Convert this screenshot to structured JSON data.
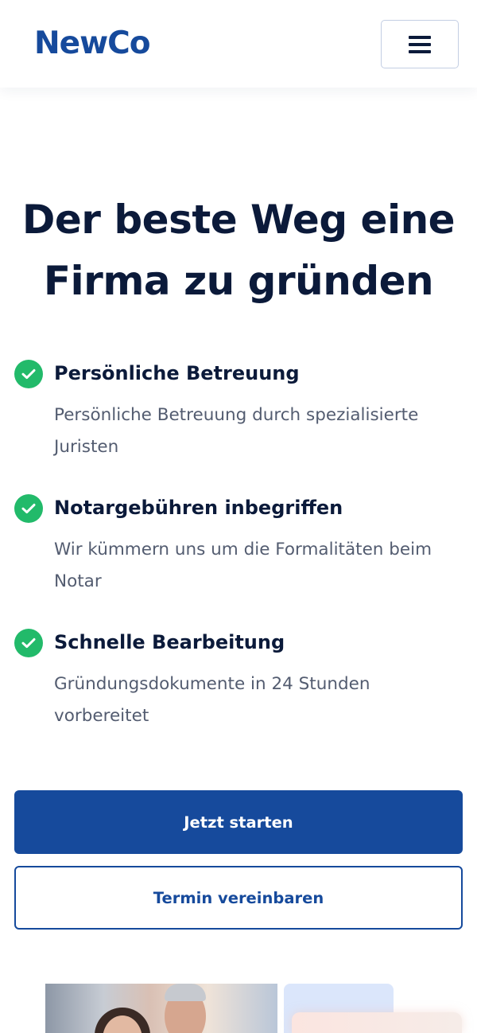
{
  "header": {
    "logo_text": "NewCo",
    "menu_icon": "hamburger-menu-icon"
  },
  "hero": {
    "title_line1": "Der beste Weg eine",
    "title_line2": "Firma zu gründen"
  },
  "features": [
    {
      "icon": "check-circle-icon",
      "title": "Persönliche Betreuung",
      "description": "Persönliche Betreuung durch spezialisierte Juristen"
    },
    {
      "icon": "check-circle-icon",
      "title": "Notargebühren inbegriffen",
      "description": "Wir kümmern uns um die Formalitäten beim Notar"
    },
    {
      "icon": "check-circle-icon",
      "title": "Schnelle Bearbeitung",
      "description": "Gründungsdokumente in 24 Stunden vorbereitet"
    }
  ],
  "actions": {
    "primary_label": "Jetzt starten",
    "secondary_label": "Termin vereinbaren"
  },
  "colors": {
    "brand": "#164a9c",
    "text_dark": "#0b1a3a",
    "text_muted": "#535c70",
    "check_green": "#22ba6a",
    "menu_border": "#c3cee3"
  }
}
